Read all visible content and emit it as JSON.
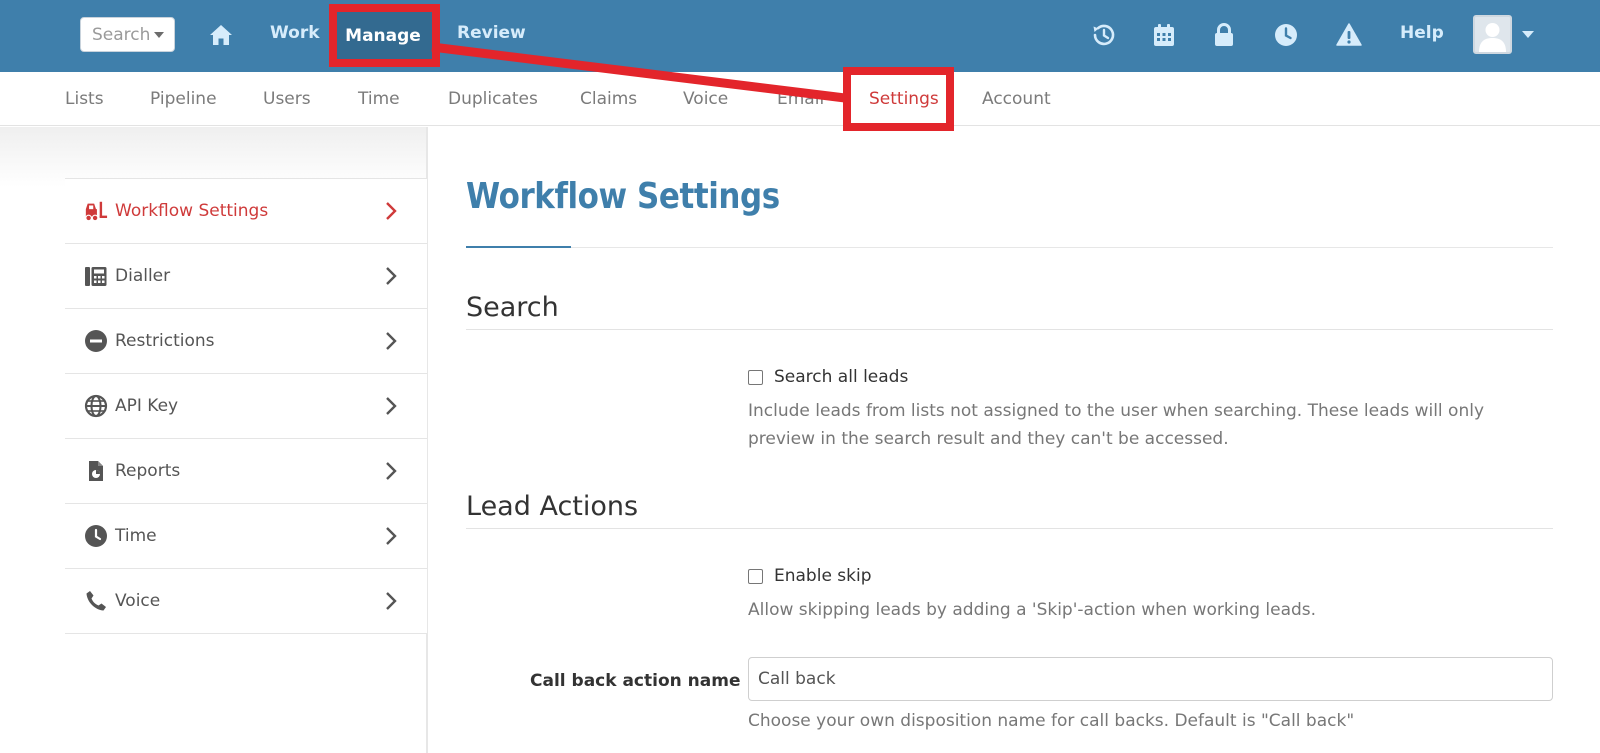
{
  "topbar": {
    "search_label": "Search",
    "nav": {
      "work": "Work",
      "manage": "Manage",
      "review": "Review",
      "help": "Help"
    },
    "icons": [
      "home-icon",
      "history-icon",
      "calendar-icon",
      "lock-icon",
      "clock-icon",
      "warning-icon",
      "avatar",
      "chevron-down-icon"
    ],
    "colors": {
      "bar": "#3f7fab",
      "active_tab": "#336a90",
      "link": "#d6ecfb"
    }
  },
  "subnav": {
    "items": [
      "Lists",
      "Pipeline",
      "Users",
      "Time",
      "Duplicates",
      "Claims",
      "Voice",
      "Email",
      "Settings",
      "Account"
    ],
    "active": "Settings",
    "colors": {
      "active": "#cf3a3a",
      "default": "#7b7b7b"
    }
  },
  "sidebar": {
    "items": [
      {
        "label": "Workflow Settings",
        "icon": "forklift-icon"
      },
      {
        "label": "Dialler",
        "icon": "fax-icon"
      },
      {
        "label": "Restrictions",
        "icon": "minus-circle-icon"
      },
      {
        "label": "API Key",
        "icon": "globe-icon"
      },
      {
        "label": "Reports",
        "icon": "file-chart-icon"
      },
      {
        "label": "Time",
        "icon": "clock-icon"
      },
      {
        "label": "Voice",
        "icon": "phone-icon"
      }
    ],
    "active": "Workflow Settings"
  },
  "main": {
    "title": "Workflow Settings",
    "sections": {
      "search": {
        "heading": "Search",
        "checkbox_label": "Search all leads",
        "help": "Include leads from lists not assigned to the user when searching. These leads will only preview in the search result and they can't be accessed."
      },
      "lead_actions": {
        "heading": "Lead Actions",
        "checkbox_label": "Enable skip",
        "help": "Allow skipping leads by adding a 'Skip'-action when working leads.",
        "callback_label": "Call back action name",
        "callback_value": "Call back",
        "callback_help": "Choose your own disposition name for call backs. Default is \"Call back\""
      }
    }
  },
  "annotation": {
    "color": "#e3252b"
  }
}
